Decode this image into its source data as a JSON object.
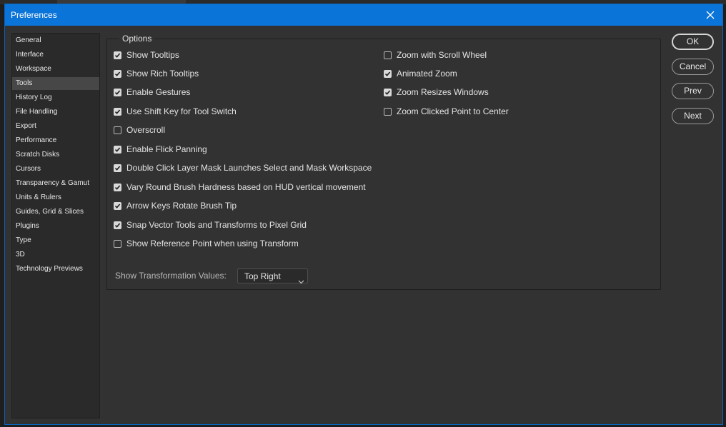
{
  "window": {
    "title": "Preferences",
    "close_icon": "close-icon"
  },
  "sidebar": {
    "items": [
      {
        "label": "General",
        "selected": false
      },
      {
        "label": "Interface",
        "selected": false
      },
      {
        "label": "Workspace",
        "selected": false
      },
      {
        "label": "Tools",
        "selected": true
      },
      {
        "label": "History Log",
        "selected": false
      },
      {
        "label": "File Handling",
        "selected": false
      },
      {
        "label": "Export",
        "selected": false
      },
      {
        "label": "Performance",
        "selected": false
      },
      {
        "label": "Scratch Disks",
        "selected": false
      },
      {
        "label": "Cursors",
        "selected": false
      },
      {
        "label": "Transparency & Gamut",
        "selected": false
      },
      {
        "label": "Units & Rulers",
        "selected": false
      },
      {
        "label": "Guides, Grid & Slices",
        "selected": false
      },
      {
        "label": "Plugins",
        "selected": false
      },
      {
        "label": "Type",
        "selected": false
      },
      {
        "label": "3D",
        "selected": false
      },
      {
        "label": "Technology Previews",
        "selected": false
      }
    ]
  },
  "options": {
    "legend": "Options",
    "left_column": [
      {
        "label": "Show Tooltips",
        "checked": true
      },
      {
        "label": "Show Rich Tooltips",
        "checked": true
      },
      {
        "label": "Enable Gestures",
        "checked": true
      },
      {
        "label": "Use Shift Key for Tool Switch",
        "checked": true
      },
      {
        "label": "Overscroll",
        "checked": false
      },
      {
        "label": "Enable Flick Panning",
        "checked": true
      },
      {
        "label": "Double Click Layer Mask Launches Select and Mask Workspace",
        "checked": true
      },
      {
        "label": "Vary Round Brush Hardness based on HUD vertical movement",
        "checked": true
      },
      {
        "label": "Arrow Keys Rotate Brush Tip",
        "checked": true
      },
      {
        "label": "Snap Vector Tools and Transforms to Pixel Grid",
        "checked": true
      },
      {
        "label": "Show Reference Point when using Transform",
        "checked": false
      }
    ],
    "right_column": [
      {
        "label": "Zoom with Scroll Wheel",
        "checked": false
      },
      {
        "label": "Animated Zoom",
        "checked": true
      },
      {
        "label": "Zoom Resizes Windows",
        "checked": true
      },
      {
        "label": "Zoom Clicked Point to Center",
        "checked": false
      }
    ],
    "transformation_values": {
      "label": "Show Transformation Values:",
      "selected": "Top Right"
    }
  },
  "buttons": {
    "ok": "OK",
    "cancel": "Cancel",
    "prev": "Prev",
    "next": "Next"
  },
  "colors": {
    "titlebar": "#0b74d8",
    "dialog_bg": "#323232",
    "sidebar_selected": "#474747"
  }
}
